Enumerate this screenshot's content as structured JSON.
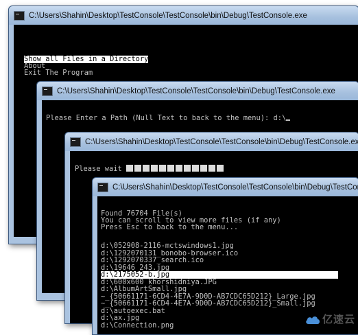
{
  "windows": [
    {
      "title": "C:\\Users\\Shahin\\Desktop\\TestConsole\\TestConsole\\bin\\Debug\\TestConsole.exe",
      "menu": [
        "Show all Files in a Directory",
        "About",
        "Exit The Program"
      ]
    },
    {
      "title": "C:\\Users\\Shahin\\Desktop\\TestConsole\\TestConsole\\bin\\Debug\\TestConsole.exe",
      "prompt": "Please Enter a Path (Null Text to back to the menu): d:\\"
    },
    {
      "title": "C:\\Users\\Shahin\\Desktop\\TestConsole\\TestConsole\\bin\\Debug\\TestConsole.exe",
      "wait_text": "Please wait",
      "progress_blocks": 12
    },
    {
      "title": "C:\\Users\\Shahin\\Desktop\\TestConsole\\TestConsole\\bin\\Debug\\TestConsole.exe",
      "header": [
        "Found 76704 File(s)",
        "You can scroll to view more files (if any)",
        "Press Esc to back to the menu..."
      ],
      "files": [
        "d:\\052908-2116-mctswindows1.jpg",
        "d:\\1292070131_bonobo-browser.ico",
        "d:\\1292070337_search.ico",
        "d:\\19646_243.jpg",
        "d:\\2175052-b.jpg",
        "d:\\600x600 khorshidniya.JPG",
        "d:\\AlbumArtSmall.jpg",
        "~_{50661171-6CD4-4E7A-9D0D-AB7CDC65D212}_Large.jpg",
        "~_{50661171-6CD4-4E7A-9D0D-AB7CDC65D212}_Small.jpg",
        "d:\\autoexec.bat",
        "d:\\ax.jpg",
        "d:\\Connection.png"
      ],
      "selected_index": 4
    }
  ],
  "watermark": {
    "text": "亿速云"
  }
}
